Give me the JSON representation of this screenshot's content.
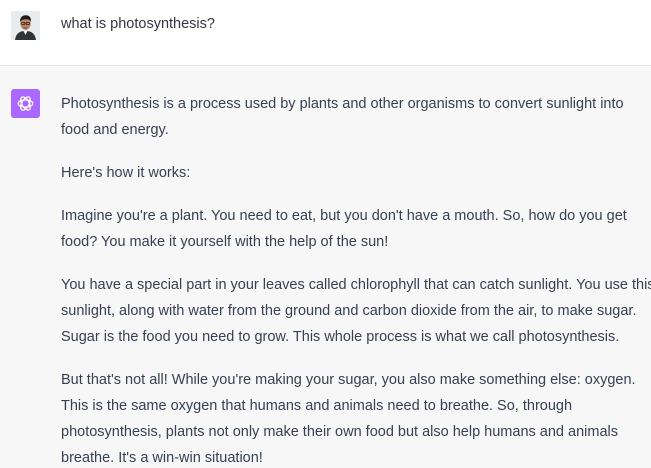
{
  "conversation": {
    "user": {
      "avatar": "user-avatar-photo",
      "message": "what is photosynthesis?"
    },
    "assistant": {
      "avatar_icon": "openai-logo-icon",
      "avatar_color": "#ab68ff",
      "paragraphs": [
        {
          "lines": [
            "Photosynthesis is a process used by plants and other organisms to convert sunlight into",
            "food and energy."
          ]
        },
        {
          "lines": [
            "Here's how it works:"
          ]
        },
        {
          "lines": [
            "Imagine you're a plant. You need to eat, but you don't have a mouth. So, how do you get",
            "food? You make it yourself with the help of the sun!"
          ]
        },
        {
          "lines": [
            "You have a special part in your leaves called chlorophyll that can catch sunlight. You use this",
            "sunlight, along with water from the ground and carbon dioxide from the air, to make sugar.",
            "Sugar is the food you need to grow. This whole process is what we call photosynthesis."
          ]
        },
        {
          "lines": [
            "But that's not all! While you're making your sugar, you also make something else: oxygen.",
            "This is the same oxygen that humans and animals need to breathe. So, through",
            "photosynthesis, plants not only make their own food but also help humans and animals",
            "breathe. It's a win-win situation!"
          ]
        }
      ]
    }
  }
}
